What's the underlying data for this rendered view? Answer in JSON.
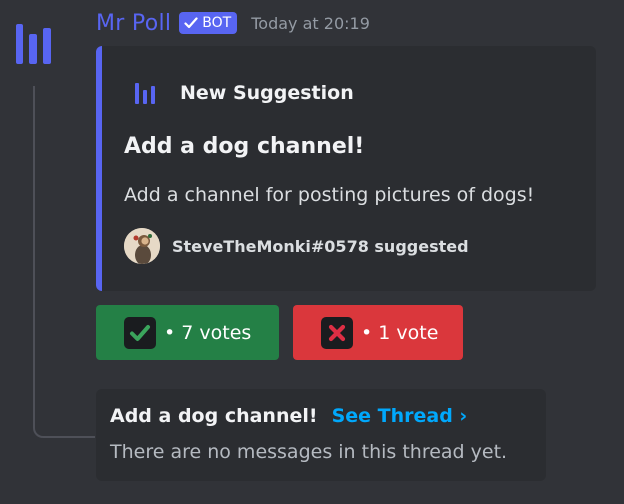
{
  "message": {
    "author": "Mr Poll",
    "bot_tag": "BOT",
    "timestamp": "Today at 20:19",
    "avatar_icon": "poll-bars-icon"
  },
  "embed": {
    "author_icon": "poll-bars-icon",
    "author_name": "New Suggestion",
    "title": "Add a dog channel!",
    "description": "Add a channel for posting pictures of dogs!",
    "footer_icon": "user-avatar",
    "footer_text": "SteveTheMonki#0578 suggested",
    "accent_color": "#5865f2"
  },
  "votes": [
    {
      "icon": "check-mark-icon",
      "label": "• 7 votes",
      "color": "#248046"
    },
    {
      "icon": "cross-mark-icon",
      "label": "• 1 vote",
      "color": "#da373c"
    }
  ],
  "thread": {
    "name": "Add a dog channel!",
    "link": "See Thread ›",
    "empty_text": "There are no messages in this thread yet."
  },
  "colors": {
    "background": "#313338",
    "embed_background": "#2b2d31",
    "brand": "#5865f2",
    "link": "#00a8fc"
  }
}
